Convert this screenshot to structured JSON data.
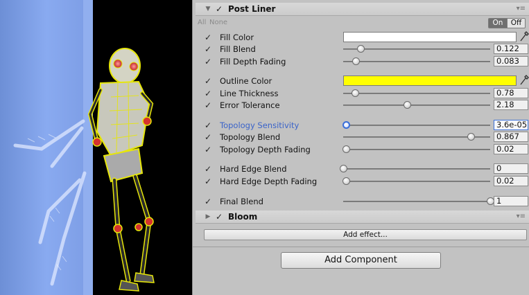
{
  "post_liner": {
    "title": "Post Liner",
    "all_label": "All",
    "none_label": "None",
    "on_label": "On",
    "off_label": "Off",
    "menu_icon": "menu-icon",
    "properties": [
      {
        "label": "Fill Color",
        "type": "color",
        "color": "#ffffff"
      },
      {
        "label": "Fill Blend",
        "type": "slider",
        "value": "0.122",
        "level": 0.12
      },
      {
        "label": "Fill Depth Fading",
        "type": "slider",
        "value": "0.083",
        "level": 0.083
      },
      {
        "label": "Outline Color",
        "type": "color",
        "color": "#ffff00"
      },
      {
        "label": "Line Thickness",
        "type": "slider",
        "value": "0.78",
        "level": 0.078
      },
      {
        "label": "Error Tolerance",
        "type": "slider",
        "value": "2.18",
        "level": 0.436
      },
      {
        "label": "Topology Sensitivity",
        "type": "slider",
        "value": "3.6e-05",
        "level": 0.02,
        "focused": true
      },
      {
        "label": "Topology Blend",
        "type": "slider",
        "value": "0.867",
        "level": 0.867
      },
      {
        "label": "Topology Depth Fading",
        "type": "slider",
        "value": "0.02",
        "level": 0.02
      },
      {
        "label": "Hard Edge Blend",
        "type": "slider",
        "value": "0",
        "level": 0
      },
      {
        "label": "Hard Edge Depth Fading",
        "type": "slider",
        "value": "0.02",
        "level": 0.02
      },
      {
        "label": "Final Blend",
        "type": "slider",
        "value": "1",
        "level": 1
      }
    ]
  },
  "bloom": {
    "title": "Bloom",
    "menu_icon": "menu-icon"
  },
  "add_effect_label": "Add effect...",
  "add_component_label": "Add Component",
  "colors": {
    "inspector_bg": "#c2c2c2",
    "highlight_label": "#3a63c9",
    "outline_yellow": "#ffff00"
  }
}
